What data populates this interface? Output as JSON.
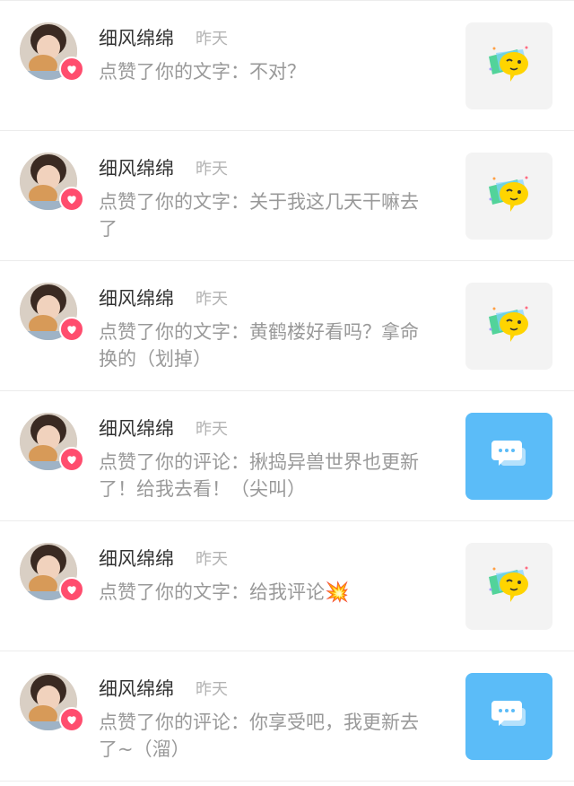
{
  "notifications": [
    {
      "username": "细风绵绵",
      "time": "昨天",
      "text": "点赞了你的文字：不对？",
      "thumb_icon": "emoji-face-icon",
      "badge_icon": "heart-icon"
    },
    {
      "username": "细风绵绵",
      "time": "昨天",
      "text": "点赞了你的文字：关于我这几天干嘛去了",
      "thumb_icon": "emoji-face-icon",
      "badge_icon": "heart-icon"
    },
    {
      "username": "细风绵绵",
      "time": "昨天",
      "text": "点赞了你的文字：黄鹤楼好看吗？拿命换的（划掉）",
      "thumb_icon": "emoji-face-icon",
      "badge_icon": "heart-icon"
    },
    {
      "username": "细风绵绵",
      "time": "昨天",
      "text": "点赞了你的评论：揪捣异兽世界也更新了！给我去看！（尖叫）",
      "thumb_icon": "chat-bubble-icon",
      "badge_icon": "heart-icon"
    },
    {
      "username": "细风绵绵",
      "time": "昨天",
      "text": "点赞了你的文字：给我评论",
      "text_emoji": "💥",
      "thumb_icon": "emoji-face-icon",
      "badge_icon": "heart-icon"
    },
    {
      "username": "细风绵绵",
      "time": "昨天",
      "text": "点赞了你的评论：你享受吧，我更新去了~（溜）",
      "thumb_icon": "chat-bubble-icon",
      "badge_icon": "heart-icon"
    }
  ],
  "colors": {
    "heart_badge": "#ff4d6e",
    "comment_thumb": "#5bbcf8",
    "emoji_yellow": "#ffd400",
    "name_text": "#333333",
    "muted_text": "#999999"
  }
}
